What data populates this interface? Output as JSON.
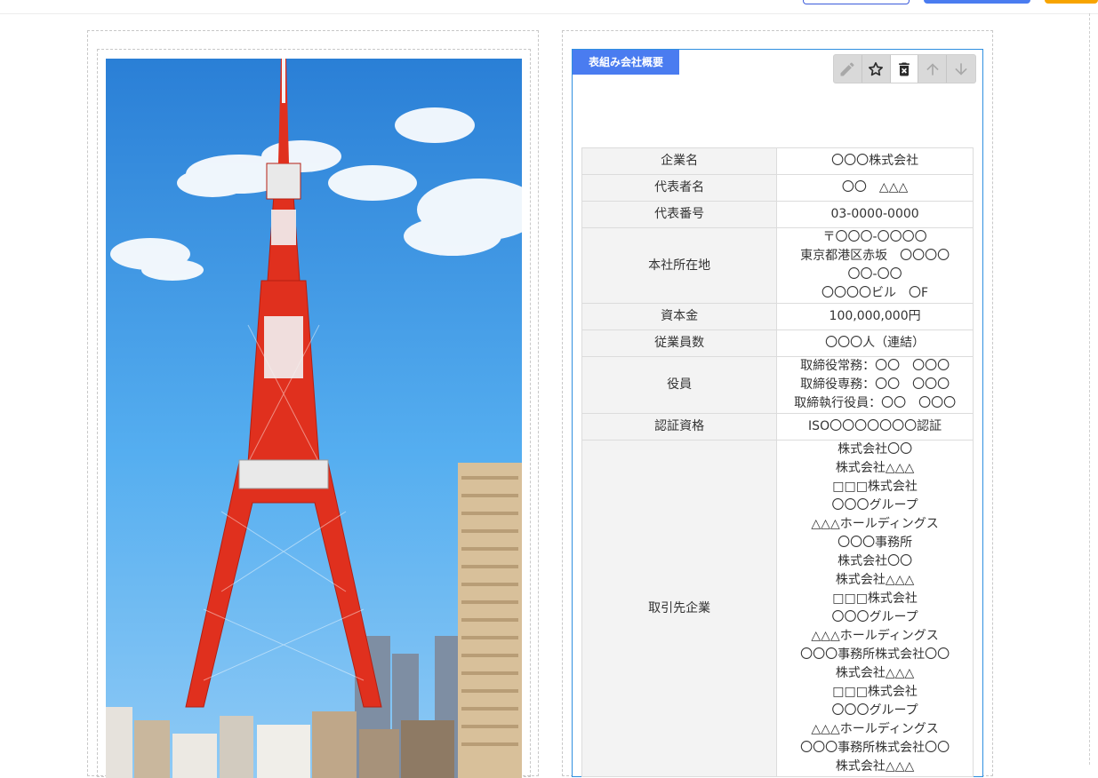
{
  "block": {
    "label": "表組み会社概要"
  },
  "toolbar": {
    "icons": [
      "pencil-icon",
      "star-icon",
      "trash-icon",
      "arrow-up-icon",
      "arrow-down-icon"
    ]
  },
  "table": {
    "rows": [
      {
        "label": "企業名",
        "lines": [
          "〇〇〇株式会社"
        ]
      },
      {
        "label": "代表者名",
        "lines": [
          "〇〇　△△△"
        ]
      },
      {
        "label": "代表番号",
        "lines": [
          "03-0000-0000"
        ]
      },
      {
        "label": "本社所在地",
        "lines": [
          "〒〇〇〇-〇〇〇〇",
          "東京都港区赤坂　〇〇〇〇",
          "〇〇-〇〇",
          "〇〇〇〇ビル　〇F"
        ]
      },
      {
        "label": "資本金",
        "lines": [
          "100,000,000円"
        ]
      },
      {
        "label": "従業員数",
        "lines": [
          "〇〇〇人（連結）"
        ]
      },
      {
        "label": "役員",
        "lines": [
          "取締役常務：〇〇　〇〇〇",
          "取締役専務：〇〇　〇〇〇",
          "取締執行役員：〇〇　〇〇〇"
        ]
      },
      {
        "label": "認証資格",
        "lines": [
          "ISO〇〇〇〇〇〇〇認証"
        ]
      },
      {
        "label": "取引先企業",
        "lines": [
          "株式会社〇〇",
          "株式会社△△△",
          "□□□株式会社",
          "〇〇〇グループ",
          "△△△ホールディングス",
          "〇〇〇事務所",
          "株式会社〇〇",
          "株式会社△△△",
          "□□□株式会社",
          "〇〇〇グループ",
          "△△△ホールディングス",
          "〇〇〇事務所株式会社〇〇",
          "株式会社△△△",
          "□□□株式会社",
          "〇〇〇グループ",
          "△△△ホールディングス",
          "〇〇〇事務所株式会社〇〇",
          "株式会社△△△"
        ]
      }
    ]
  },
  "colors": {
    "accent": "#4a7cf0",
    "block_border": "#2f8fe0",
    "header_cell": "#f3f3f3",
    "tower_red": "#e0301e",
    "sky": "#4aa3e6"
  }
}
